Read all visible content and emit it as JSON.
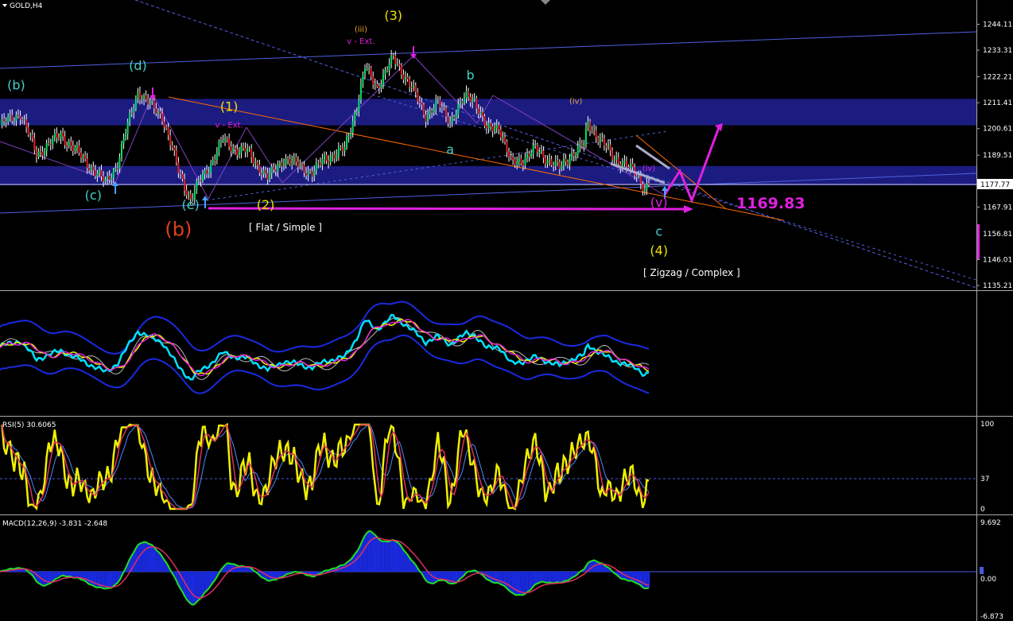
{
  "window": {
    "symbol_label": "GOLD,H4"
  },
  "price_axis": {
    "ticks": [
      1244.11,
      1233.31,
      1222.21,
      1211.41,
      1200.61,
      1189.51,
      1177.77,
      1167.91,
      1156.81,
      1146.01,
      1135.21
    ],
    "tick_labels": [
      "1244.11",
      "1233.31",
      "1222.21",
      "1211.41",
      "1200.61",
      "1189.51",
      "1177.77",
      "1167.91",
      "1156.81",
      "1146.01",
      "1135.21"
    ],
    "current_price_label": "1177.77"
  },
  "target": {
    "value": 1169.83,
    "label": "1169.83",
    "color": "#e020e0"
  },
  "pattern_labels": {
    "flat": "[ Flat / Simple ]",
    "zigzag": "[ Zigzag / Complex ]"
  },
  "wave_labels": [
    {
      "text": "(b)",
      "x": 8,
      "y": 1217,
      "color": "#44d0c8"
    },
    {
      "text": "(c)",
      "x": 46,
      "y": 1171,
      "color": "#44d0c8"
    },
    {
      "text": "(d)",
      "x": 68,
      "y": 1225,
      "color": "#44d0c8"
    },
    {
      "text": "(e)",
      "x": 94,
      "y": 1167,
      "color": "#44d0c8"
    },
    {
      "text": "(b)",
      "x": 88,
      "y": 1156,
      "color": "#e0401c"
    },
    {
      "text": "(1)",
      "x": 113,
      "y": 1208,
      "color": "#f0e000"
    },
    {
      "text": "v - Ext.",
      "x": 113,
      "y": 1201,
      "color": "#e020e0"
    },
    {
      "text": "(2)",
      "x": 131,
      "y": 1167,
      "color": "#f0e000"
    },
    {
      "text": "(3)",
      "x": 194,
      "y": 1246,
      "color": "#f0e000"
    },
    {
      "text": "(iii)",
      "x": 178,
      "y": 1241,
      "color": "#e8a030"
    },
    {
      "text": "v - Ext.",
      "x": 178,
      "y": 1236,
      "color": "#e020e0"
    },
    {
      "text": "b",
      "x": 232,
      "y": 1221,
      "color": "#44d0c8"
    },
    {
      "text": "a",
      "x": 222,
      "y": 1190,
      "color": "#44d0c8"
    },
    {
      "text": "(iv)",
      "x": 284,
      "y": 1211,
      "color": "#e8a030"
    },
    {
      "text": "(4)",
      "x": 325,
      "y": 1148,
      "color": "#f0e000"
    },
    {
      "text": "c",
      "x": 325,
      "y": 1156,
      "color": "#44d0c8"
    },
    {
      "text": "(iv)",
      "x": 320,
      "y": 1183,
      "color": "#e020e0"
    },
    {
      "text": "(v)",
      "x": 325,
      "y": 1168,
      "color": "#e020e0"
    }
  ],
  "chart_data": [
    {
      "type": "candlestick",
      "title": "GOLD,H4",
      "ylim": [
        1132,
        1252
      ],
      "x_count": 340,
      "close_anchors": [
        [
          0,
          1202
        ],
        [
          10,
          1207
        ],
        [
          18,
          1190
        ],
        [
          30,
          1198
        ],
        [
          40,
          1189
        ],
        [
          52,
          1178
        ],
        [
          58,
          1186
        ],
        [
          64,
          1205
        ],
        [
          68,
          1216
        ],
        [
          72,
          1212
        ],
        [
          80,
          1206
        ],
        [
          88,
          1183
        ],
        [
          94,
          1171
        ],
        [
          98,
          1178
        ],
        [
          104,
          1186
        ],
        [
          110,
          1196
        ],
        [
          116,
          1192
        ],
        [
          122,
          1191
        ],
        [
          132,
          1180
        ],
        [
          140,
          1188
        ],
        [
          148,
          1185
        ],
        [
          154,
          1182
        ],
        [
          160,
          1188
        ],
        [
          170,
          1192
        ],
        [
          176,
          1210
        ],
        [
          180,
          1226
        ],
        [
          186,
          1218
        ],
        [
          190,
          1224
        ],
        [
          194,
          1230
        ],
        [
          198,
          1225
        ],
        [
          204,
          1216
        ],
        [
          210,
          1206
        ],
        [
          216,
          1211
        ],
        [
          222,
          1204
        ],
        [
          230,
          1214
        ],
        [
          234,
          1213
        ],
        [
          240,
          1200
        ],
        [
          246,
          1202
        ],
        [
          252,
          1186
        ],
        [
          258,
          1188
        ],
        [
          264,
          1192
        ],
        [
          270,
          1188
        ],
        [
          276,
          1184
        ],
        [
          282,
          1190
        ],
        [
          288,
          1194
        ],
        [
          290,
          1203
        ],
        [
          296,
          1196
        ],
        [
          302,
          1189
        ],
        [
          308,
          1186
        ],
        [
          314,
          1181
        ],
        [
          318,
          1176
        ],
        [
          320,
          1178
        ]
      ],
      "resistance_zones": [
        [
          1202,
          1213
        ],
        [
          1177,
          1185
        ]
      ]
    },
    {
      "type": "line",
      "title": "",
      "ylim": [
        0,
        1
      ],
      "series": [
        {
          "name": "",
          "values": []
        }
      ]
    },
    {
      "type": "line",
      "title": "RSI(5) 30.6065",
      "ylim": [
        0,
        100
      ],
      "levels": [
        37
      ],
      "axis_labels": [
        "100",
        "37",
        "0"
      ],
      "series": [
        {
          "name": "RSI",
          "last": 30.6065
        }
      ]
    },
    {
      "type": "bar",
      "title": "MACD(12,26,9) -3.831 -2.648",
      "ylim": [
        -6.873,
        9.692
      ],
      "axis_labels": [
        "9.692",
        "0.00",
        "-6.873"
      ],
      "series": [
        {
          "name": "MACD",
          "last": -3.831
        },
        {
          "name": "Signal",
          "last": -2.648
        }
      ]
    }
  ],
  "colors": {
    "bull_candle": "#00e060",
    "bear_candle": "#e02020",
    "zone": "#1c1c80",
    "channel": "#5060e0",
    "orange_line": "#ff6a00",
    "magenta": "#e020e0",
    "rsi_line": "#f0f000",
    "macd_hist": "#1a2ae0",
    "macd_line": "#20e020",
    "signal_line": "#e03060"
  }
}
